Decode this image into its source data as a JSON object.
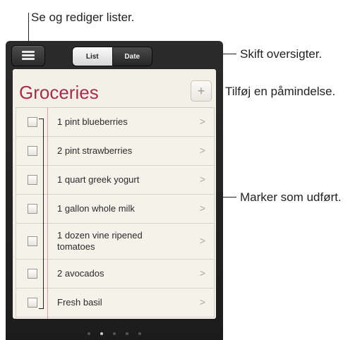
{
  "callouts": {
    "menu": "Se og rediger lister.",
    "views": "Skift oversigter.",
    "add": "Tilføj en påmindelse.",
    "complete": "Marker som udført."
  },
  "toolbar": {
    "menu_icon": "menu-icon",
    "segments": [
      "List",
      "Date"
    ],
    "selected_segment": "List"
  },
  "list": {
    "title": "Groceries",
    "add_symbol": "+",
    "items": [
      {
        "label": "1 pint blueberries",
        "completed": false
      },
      {
        "label": "2 pint strawberries",
        "completed": false
      },
      {
        "label": "1 quart greek yogurt",
        "completed": false
      },
      {
        "label": "1 gallon whole milk",
        "completed": false
      },
      {
        "label": "1 dozen vine ripened tomatoes",
        "completed": false
      },
      {
        "label": "2 avocados",
        "completed": false
      },
      {
        "label": "Fresh basil",
        "completed": false
      }
    ]
  },
  "pager": {
    "pages": 5,
    "current": 2
  }
}
